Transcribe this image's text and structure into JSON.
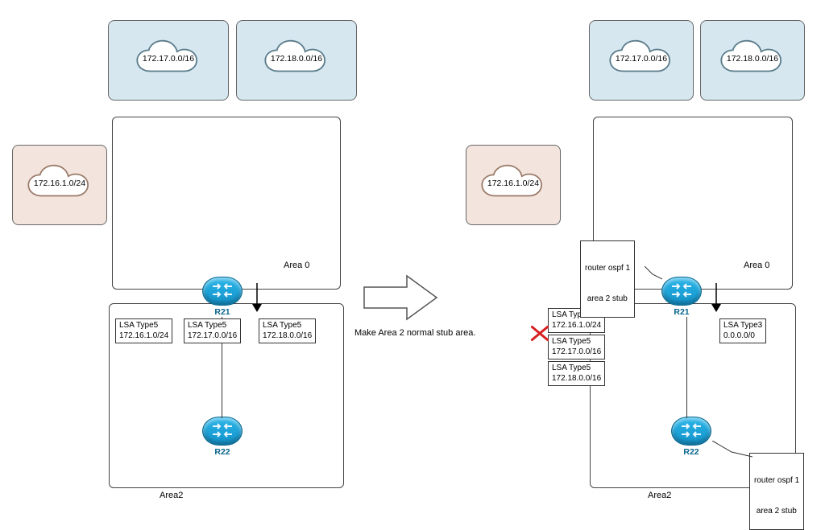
{
  "clouds": {
    "left_blue1": "172.17.0.0/16",
    "left_blue2": "172.18.0.0/16",
    "left_pink": "172.16.1.0/24",
    "right_blue1": "172.17.0.0/16",
    "right_blue2": "172.18.0.0/16",
    "right_pink": "172.16.1.0/24"
  },
  "routers": {
    "r21": "R21",
    "r22": "R22"
  },
  "areas": {
    "area0": "Area 0",
    "area2": "Area2"
  },
  "lsa": {
    "left1_l1": "LSA Type5",
    "left1_l2": "172.16.1.0/24",
    "left2_l1": "LSA Type5",
    "left2_l2": "172.17.0.0/16",
    "left3_l1": "LSA Type5",
    "left3_l2": "172.18.0.0/16",
    "right_block1_l1": "LSA Type5",
    "right_block1_l2": "172.16.1.0/24",
    "right_block2_l1": "LSA Type5",
    "right_block2_l2": "172.17.0.0/16",
    "right_block3_l1": "LSA Type5",
    "right_block3_l2": "172.18.0.0/16",
    "right_ok_l1": "LSA Type3",
    "right_ok_l2": "0.0.0.0/0"
  },
  "config": {
    "r21_l1": "router ospf 1",
    "r21_l2": " area 2 stub",
    "r22_l1": "router ospf 1",
    "r22_l2": " area 2 stub"
  },
  "middle_text": "Make Area 2 normal stub area."
}
